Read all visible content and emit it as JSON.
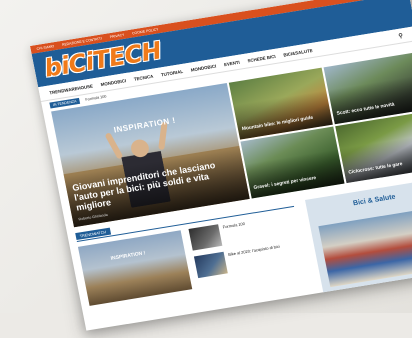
{
  "topbar": {
    "links": [
      "CHI SIAMO",
      "REDAZIONE E CONTATTI",
      "PRIVACY",
      "COOKIE POLICY"
    ]
  },
  "header": {
    "logo_text": "biCiTECH"
  },
  "nav": {
    "items": [
      "TRENDWAREHOUSE",
      "MONDOBICI",
      "TECNICA",
      "TUTORIAL",
      "MONDOBICI",
      "EVENTI",
      "SCHEDE BICI",
      "BICI&SALUTE"
    ],
    "search_icon": "search-icon"
  },
  "ticker": {
    "tag": "IN TENDENZA",
    "text": "Formula 100"
  },
  "hero": {
    "overlay_text": "INSPIRATION !",
    "title": "Giovani imprenditori che lasciano l'auto per la bici: più soldi e vita migliore",
    "meta": "Roberto Ghirlanda"
  },
  "tiles": [
    {
      "title": "Mountain bike: le migliori guide"
    },
    {
      "title": "Scott: ecco tutte le novità"
    },
    {
      "title": "Gravel: i segreti per vincere"
    },
    {
      "title": "Ciclocross: tutte le gare"
    }
  ],
  "lower": {
    "section_label": "TRENDWATCH",
    "big_thumb_overlay": "INSPIRATION !",
    "list": [
      {
        "title": "Formula 100",
        "date": ""
      },
      {
        "title": "Bike al 2020: l'acquisto di bici",
        "date": ""
      }
    ]
  },
  "widget": {
    "title": "Bici & Salute"
  }
}
